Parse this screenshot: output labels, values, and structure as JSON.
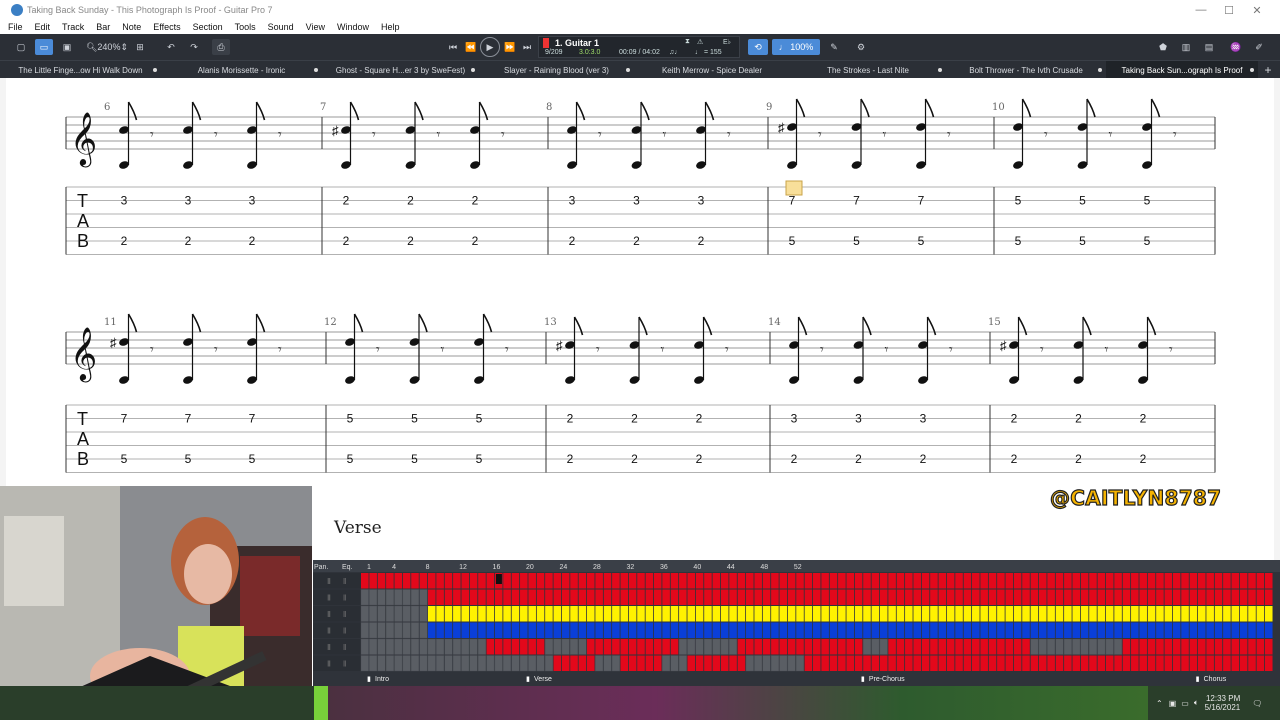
{
  "window": {
    "title": "Taking Back Sunday - This Photograph Is Proof - Guitar Pro 7",
    "controls": [
      "—",
      "☐",
      "✕"
    ]
  },
  "menu": [
    "File",
    "Edit",
    "Track",
    "Bar",
    "Note",
    "Effects",
    "Section",
    "Tools",
    "Sound",
    "View",
    "Window",
    "Help"
  ],
  "toolbar": {
    "zoom": "240%",
    "track_name": "1. Guitar 1",
    "bar_position": "9/209",
    "time_signature": "3.0:3.0",
    "time": "00:09 / 04:02",
    "tempo": "♩ = 155",
    "key": "E♭",
    "speed": "100%"
  },
  "tabs": [
    "The Little Finge...ow Hi Walk Down",
    "Alanis Morissette - Ironic",
    "Ghost - Square H...er 3 by SweFest)",
    "Slayer - Raining Blood (ver 3)",
    "Keith Merrow - Spice Dealer",
    "The Strokes - Last Nite",
    "Bolt Thrower - The Ivth Crusade",
    "Taking Back Sun...ograph Is Proof"
  ],
  "add_tab": "+",
  "score": {
    "systems": [
      {
        "measures": [
          {
            "num": "6",
            "top": "3",
            "bottom": "2",
            "sharp": false
          },
          {
            "num": "7",
            "top": "2",
            "bottom": "2",
            "sharp": true
          },
          {
            "num": "8",
            "top": "3",
            "bottom": "2",
            "sharp": false
          },
          {
            "num": "9",
            "top": "7",
            "bottom": "5",
            "sharp": true,
            "cursor": true
          },
          {
            "num": "10",
            "top": "5",
            "bottom": "5",
            "sharp": false
          }
        ]
      },
      {
        "measures": [
          {
            "num": "11",
            "top": "7",
            "bottom": "5",
            "sharp": true
          },
          {
            "num": "12",
            "top": "5",
            "bottom": "5",
            "sharp": false
          },
          {
            "num": "13",
            "top": "2",
            "bottom": "2",
            "sharp": true
          },
          {
            "num": "14",
            "top": "3",
            "bottom": "2",
            "sharp": false
          },
          {
            "num": "15",
            "top": "2",
            "bottom": "2",
            "sharp": true
          }
        ]
      }
    ],
    "tab_letters": [
      "T",
      "A",
      "B"
    ],
    "section_label": "Verse"
  },
  "watermark": "@CAITLYN8787",
  "tracks_panel": {
    "headers": [
      "Pan.",
      "Eq."
    ],
    "ruler": [
      "1",
      "4",
      "8",
      "12",
      "16",
      "20",
      "24",
      "28",
      "32",
      "36",
      "40",
      "44",
      "48",
      "52"
    ],
    "sections": [
      "Intro",
      "Verse",
      "Pre-Chorus",
      "Chorus"
    ],
    "colors": {
      "red": "#e3081b",
      "yellow": "#fff200",
      "blue": "#0a3fd8",
      "empty": "#5a5e64"
    }
  },
  "taskbar": {
    "time": "12:33 PM",
    "date": "5/16/2021"
  }
}
